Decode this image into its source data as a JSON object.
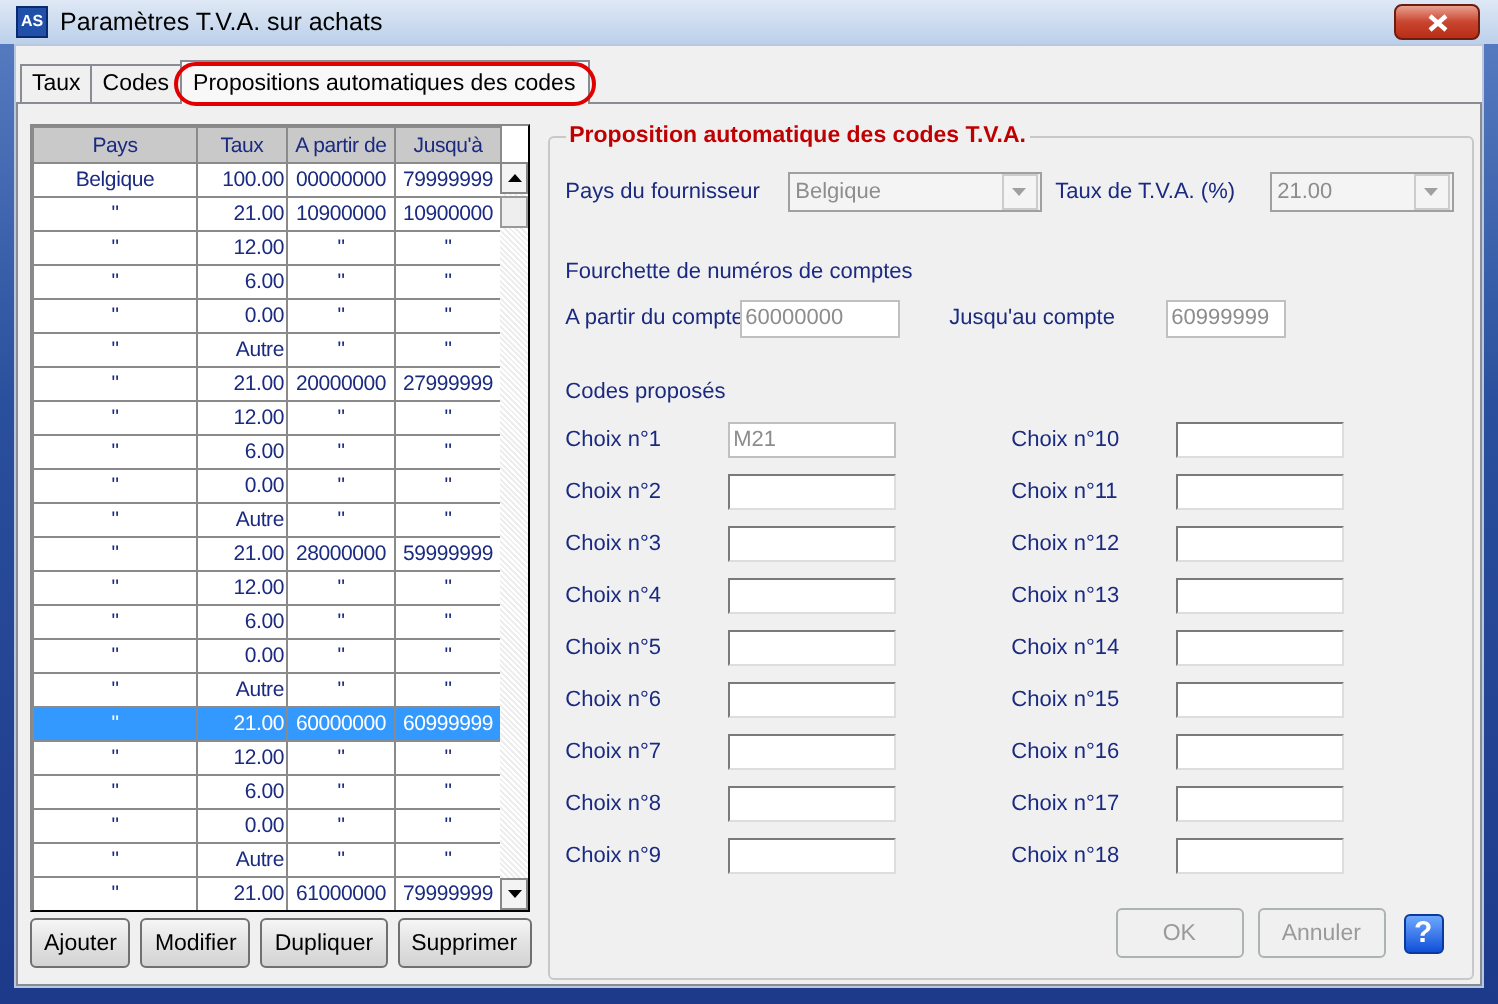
{
  "window": {
    "icon": "AS",
    "title": "Paramètres T.V.A. sur achats"
  },
  "tabs": [
    {
      "label": "Taux",
      "selected": false,
      "highlighted": false
    },
    {
      "label": "Codes",
      "selected": false,
      "highlighted": false
    },
    {
      "label": "Propositions automatiques des codes",
      "selected": true,
      "highlighted": true
    }
  ],
  "table": {
    "columns": [
      "Pays",
      "Taux",
      "A partir de",
      "Jusqu'à"
    ],
    "rows": [
      {
        "cells": [
          "Belgique",
          "100.00",
          "00000000",
          "79999999"
        ],
        "selected": false
      },
      {
        "cells": [
          "\"",
          "21.00",
          "10900000",
          "10900000"
        ],
        "selected": false
      },
      {
        "cells": [
          "\"",
          "12.00",
          "\"",
          "\""
        ],
        "selected": false
      },
      {
        "cells": [
          "\"",
          "6.00",
          "\"",
          "\""
        ],
        "selected": false
      },
      {
        "cells": [
          "\"",
          "0.00",
          "\"",
          "\""
        ],
        "selected": false
      },
      {
        "cells": [
          "\"",
          "Autre",
          "\"",
          "\""
        ],
        "selected": false
      },
      {
        "cells": [
          "\"",
          "21.00",
          "20000000",
          "27999999"
        ],
        "selected": false
      },
      {
        "cells": [
          "\"",
          "12.00",
          "\"",
          "\""
        ],
        "selected": false
      },
      {
        "cells": [
          "\"",
          "6.00",
          "\"",
          "\""
        ],
        "selected": false
      },
      {
        "cells": [
          "\"",
          "0.00",
          "\"",
          "\""
        ],
        "selected": false
      },
      {
        "cells": [
          "\"",
          "Autre",
          "\"",
          "\""
        ],
        "selected": false
      },
      {
        "cells": [
          "\"",
          "21.00",
          "28000000",
          "59999999"
        ],
        "selected": false
      },
      {
        "cells": [
          "\"",
          "12.00",
          "\"",
          "\""
        ],
        "selected": false
      },
      {
        "cells": [
          "\"",
          "6.00",
          "\"",
          "\""
        ],
        "selected": false
      },
      {
        "cells": [
          "\"",
          "0.00",
          "\"",
          "\""
        ],
        "selected": false
      },
      {
        "cells": [
          "\"",
          "Autre",
          "\"",
          "\""
        ],
        "selected": false
      },
      {
        "cells": [
          "\"",
          "21.00",
          "60000000",
          "60999999"
        ],
        "selected": true
      },
      {
        "cells": [
          "\"",
          "12.00",
          "\"",
          "\""
        ],
        "selected": false
      },
      {
        "cells": [
          "\"",
          "6.00",
          "\"",
          "\""
        ],
        "selected": false
      },
      {
        "cells": [
          "\"",
          "0.00",
          "\"",
          "\""
        ],
        "selected": false
      },
      {
        "cells": [
          "\"",
          "Autre",
          "\"",
          "\""
        ],
        "selected": false
      },
      {
        "cells": [
          "\"",
          "21.00",
          "61000000",
          "79999999"
        ],
        "selected": false
      }
    ]
  },
  "table_buttons": [
    "Ajouter",
    "Modifier",
    "Dupliquer",
    "Supprimer"
  ],
  "group": {
    "title": "Proposition automatique des codes T.V.A.",
    "supplier_country": {
      "label": "Pays du fournisseur",
      "value": "Belgique",
      "disabled": true
    },
    "vat_rate": {
      "label": "Taux de T.V.A. (%)",
      "value": "21.00",
      "disabled": true
    },
    "range": {
      "title": "Fourchette de numéros de comptes",
      "from": {
        "label": "A partir du compte",
        "value": "60000000",
        "disabled": true
      },
      "to": {
        "label": "Jusqu'au compte",
        "value": "60999999",
        "disabled": true
      }
    },
    "codes": {
      "title": "Codes proposés",
      "choices": [
        {
          "label": "Choix n°1",
          "value": "M21",
          "disabled": true
        },
        {
          "label": "Choix n°2",
          "disabled": false
        },
        {
          "label": "Choix n°3",
          "disabled": false
        },
        {
          "label": "Choix n°4",
          "disabled": false
        },
        {
          "label": "Choix n°5",
          "disabled": false
        },
        {
          "label": "Choix n°6",
          "disabled": false
        },
        {
          "label": "Choix n°7",
          "disabled": false
        },
        {
          "label": "Choix n°8",
          "disabled": false
        },
        {
          "label": "Choix n°9",
          "disabled": false
        },
        {
          "label": "Choix n°10",
          "disabled": false
        },
        {
          "label": "Choix n°11",
          "disabled": false
        },
        {
          "label": "Choix n°12",
          "disabled": false
        },
        {
          "label": "Choix n°13",
          "disabled": false
        },
        {
          "label": "Choix n°14",
          "disabled": false
        },
        {
          "label": "Choix n°15",
          "disabled": false
        },
        {
          "label": "Choix n°16",
          "disabled": false
        },
        {
          "label": "Choix n°17",
          "disabled": false
        },
        {
          "label": "Choix n°18",
          "disabled": false
        }
      ]
    }
  },
  "buttons": [
    {
      "label": "OK",
      "disabled": true
    },
    {
      "label": "Annuler",
      "disabled": true
    }
  ],
  "help": {
    "label": "?"
  }
}
